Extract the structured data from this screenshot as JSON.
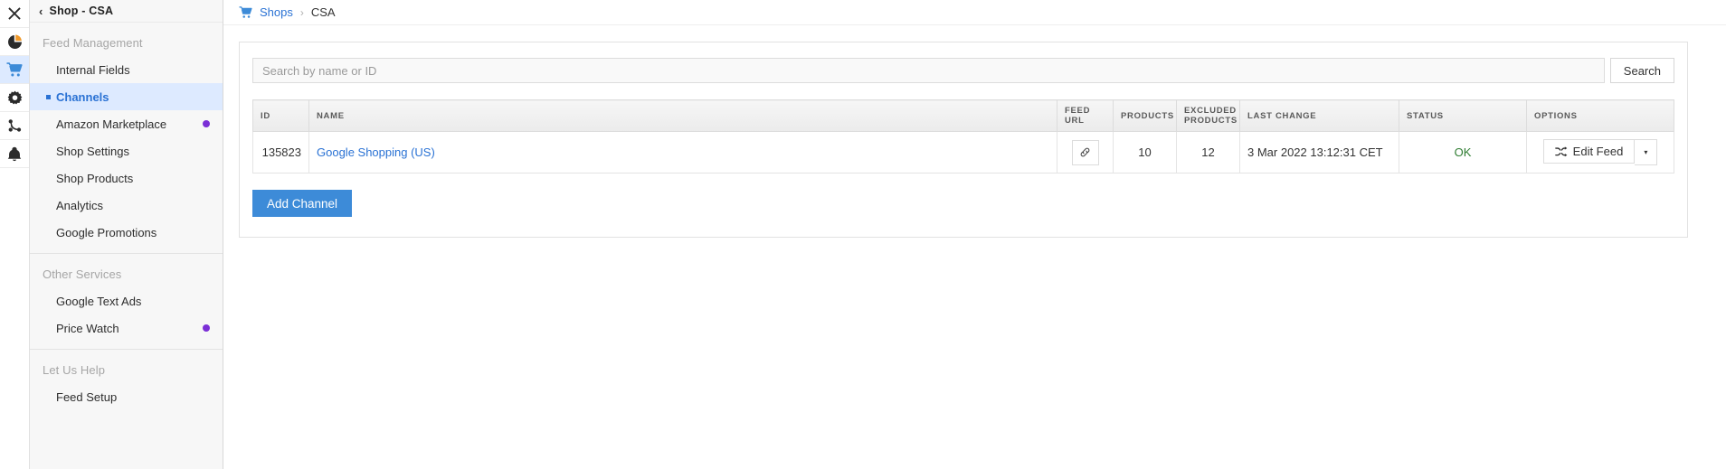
{
  "icon_rail": {
    "items": [
      {
        "name": "close-icon",
        "glyph": "close",
        "active": false
      },
      {
        "name": "pie-chart-icon",
        "glyph": "pie",
        "active": false
      },
      {
        "name": "shopping-cart-icon",
        "glyph": "cart",
        "active": true
      },
      {
        "name": "gear-icon",
        "glyph": "gear",
        "active": false
      },
      {
        "name": "share-nodes-icon",
        "glyph": "share",
        "active": false
      },
      {
        "name": "bell-icon",
        "glyph": "bell",
        "active": false
      }
    ]
  },
  "sidebar": {
    "header_title": "Shop - CSA",
    "back_label": "‹",
    "sections": [
      {
        "label": "Feed Management",
        "items": [
          {
            "label": "Internal Fields",
            "active": false,
            "dot": false
          },
          {
            "label": "Channels",
            "active": true,
            "dot": false
          },
          {
            "label": "Amazon Marketplace",
            "active": false,
            "dot": true
          },
          {
            "label": "Shop Settings",
            "active": false,
            "dot": false
          },
          {
            "label": "Shop Products",
            "active": false,
            "dot": false
          },
          {
            "label": "Analytics",
            "active": false,
            "dot": false
          },
          {
            "label": "Google Promotions",
            "active": false,
            "dot": false
          }
        ]
      },
      {
        "label": "Other Services",
        "items": [
          {
            "label": "Google Text Ads",
            "active": false,
            "dot": false
          },
          {
            "label": "Price Watch",
            "active": false,
            "dot": true
          }
        ]
      },
      {
        "label": "Let Us Help",
        "items": [
          {
            "label": "Feed Setup",
            "active": false,
            "dot": false
          }
        ]
      }
    ]
  },
  "breadcrumb": {
    "icon": "shopping-cart-icon",
    "root_label": "Shops",
    "separator": "›",
    "current_label": "CSA"
  },
  "search": {
    "placeholder": "Search by name or ID",
    "value": "",
    "button_label": "Search"
  },
  "table": {
    "columns": [
      "ID",
      "NAME",
      "FEED URL",
      "PRODUCTS",
      "EXCLUDED PRODUCTS",
      "LAST CHANGE",
      "STATUS",
      "OPTIONS"
    ],
    "rows": [
      {
        "id": "135823",
        "name": "Google Shopping (US)",
        "feed_url_icon": "link-icon",
        "products": "10",
        "excluded_products": "12",
        "last_change": "3 Mar 2022 13:12:31 CET",
        "status": "OK",
        "option_label": "Edit Feed",
        "option_icon": "shuffle-icon",
        "option_caret": "▾"
      }
    ]
  },
  "actions": {
    "add_channel_label": "Add Channel"
  },
  "colors": {
    "accent_blue": "#2a72d4",
    "button_blue": "#3d8bd8",
    "active_row_bg": "#ddeaff",
    "status_ok_green": "#2f7d32",
    "notification_dot": "#7b2fd6"
  }
}
